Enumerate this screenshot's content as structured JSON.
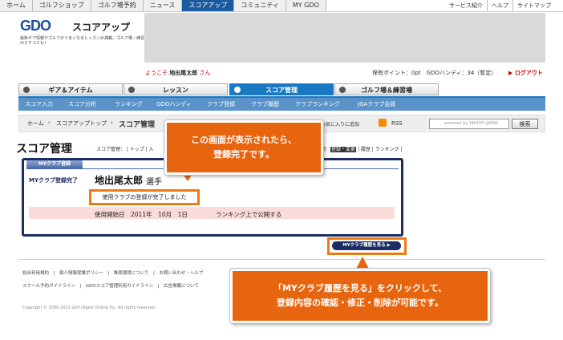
{
  "top_nav": {
    "items": [
      "ホーム",
      "ゴルフショップ",
      "ゴルフ場予約",
      "ニュース",
      "スコアアップ",
      "コミュニティ",
      "MY GDO"
    ],
    "active_index": 4,
    "right_links": [
      "サービス紹介",
      "ヘルプ",
      "サイトマップ"
    ]
  },
  "logo": {
    "brand": "GDO",
    "section": "スコアアップ",
    "tagline": "最新ギア情報やゴルフがうまくなるレッスンが満載。ゴルフ場・練習場のクチコミも！"
  },
  "welcome": {
    "prefix": "ようこそ",
    "user": "地出尾太郎",
    "suffix": "さん"
  },
  "account": {
    "points_text": "保有ポイント：0pt　GDOハンディ：34（暫定）",
    "logout": "ログアウト"
  },
  "category_tabs": [
    "ギア＆アイテム",
    "レッスン",
    "スコア管理",
    "ゴルフ場＆練習場"
  ],
  "category_active": 2,
  "sub_nav": [
    "スコア入力",
    "スコア分析",
    "ランキング",
    "GDOハンディ",
    "クラブ登録",
    "クラブ履歴",
    "クラブランキング",
    "JGAクラブ会員"
  ],
  "breadcrumb": {
    "home": "ホーム",
    "parent": "スコアアップトップ",
    "current": "スコア管理"
  },
  "tools": {
    "favorite": "お気に入りに追加",
    "rss": "RSS",
    "search_placeholder": "powered by YAHOO! JAPAN",
    "search_button": "検索"
  },
  "page": {
    "title": "スコア管理",
    "subhead_left": "スコア管理： | トップ | 入",
    "subhead_right_prefix": "理：",
    "subhead_right_active": "登録・変更",
    "subhead_right_rest": " | 履歴 | ランキング |"
  },
  "panel": {
    "tab_label": "MYクラブ登録",
    "reg_label": "MYクラブ登録完了",
    "name": "地出尾太郎",
    "name_suffix": "選手",
    "done_message": "使用クラブの登録が完了しました",
    "start_date": "使用開始日　2011年　10月　1日",
    "ranking_note": "ランキング上で公開する"
  },
  "history_button": "MYクラブ履歴を見る ▶",
  "footer": {
    "links_row1": "総合利用規約　|　個人情報保護ポリシー　|　推奨環境について　|　お問い合わせ・ヘルプ",
    "links_row2": "スクール予約ガイドライン　|　GDOスコア管理利用ガイドライン　|　広告掲載について",
    "copyright": "Copyright © 2000-2011 Golf Digest Online Inc. All rights reserved."
  },
  "callouts": {
    "first_line1": "この画面が表示されたら、",
    "first_line2": "登録完了です。",
    "second_line1": "「MYクラブ履歴を見る」をクリックして、",
    "second_line2": "登録内容の確認・修正・削除が可能です。"
  },
  "colors": {
    "accent_orange": "#e8650f",
    "nav_blue": "#1a78c2",
    "panel_navy": "#1d2c63"
  }
}
